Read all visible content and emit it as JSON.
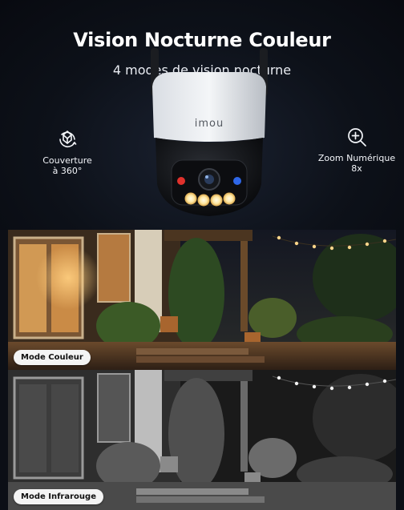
{
  "hero": {
    "title": "Vision Nocturne Couleur",
    "subtitle": "4 modes de vision nocturne"
  },
  "features": {
    "left": {
      "line1": "Couverture",
      "line2": "à 360°",
      "icon": "rotate-360-icon"
    },
    "right": {
      "line1": "Zoom Numérique",
      "line2": "8x",
      "icon": "zoom-in-icon"
    }
  },
  "camera": {
    "brand": "imou"
  },
  "panels": {
    "color": {
      "label": "Mode Couleur"
    },
    "infrared": {
      "label": "Mode Infrarouge"
    }
  },
  "colors": {
    "background": "#0c0f16",
    "light_warm": "#ffd58a",
    "accent_red": "#e0312c",
    "accent_blue": "#2f67e8"
  }
}
